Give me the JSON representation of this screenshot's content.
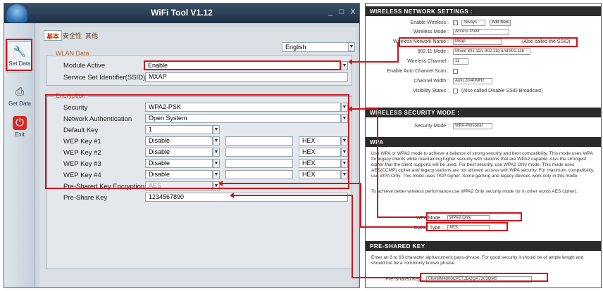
{
  "app": {
    "title": "WiFi Tool V1.12",
    "window_buttons": [
      "_",
      "□",
      "X"
    ]
  },
  "sidebar": {
    "items": [
      {
        "label": "Set Data",
        "icon": "wrench-icon"
      },
      {
        "label": "Get Data",
        "icon": "printer-icon"
      },
      {
        "label": "Exit",
        "icon": "power-icon"
      }
    ]
  },
  "tabs": [
    "基本",
    "安全性",
    "其他"
  ],
  "language": {
    "value": "English"
  },
  "wlan": {
    "title": "WLAN Data",
    "module_active_label": "Module Active",
    "module_active_value": "Enable",
    "ssid_label": "Service Set Identifier(SSID)",
    "ssid_value": "MXAP"
  },
  "encryption": {
    "title": "Encryption",
    "security_label": "Security",
    "security_value": "WPA2-PSK",
    "auth_label": "Network Authentication",
    "auth_value": "Open System",
    "default_key_label": "Default Key",
    "default_key_value": "1",
    "wep_keys": [
      {
        "label": "WEP Key #1",
        "mode": "Disable",
        "value": "",
        "format": "HEX"
      },
      {
        "label": "WEP Key #2",
        "mode": "Disable",
        "value": "",
        "format": "HEX"
      },
      {
        "label": "WEP Key #3",
        "mode": "Disable",
        "value": "",
        "format": "HEX"
      },
      {
        "label": "WEP Key #4",
        "mode": "Disable",
        "value": "",
        "format": "HEX"
      }
    ],
    "psk_enc_label": "Pre-Shared Key Encryption",
    "psk_enc_value": "AES",
    "psk_label": "Pre-Share Key",
    "psk_value": "1234567890"
  },
  "router": {
    "wireless_settings": {
      "header": "WIRELESS NETWORK SETTINGS :",
      "rows": [
        {
          "label": "Enable Wireless :",
          "value": "Always",
          "extra": "Add New"
        },
        {
          "label": "Wireless Mode :",
          "value": "Access Point"
        },
        {
          "label": "Wireless Network Name :",
          "value": "Mxap",
          "note": "(Also called the SSID)"
        },
        {
          "label": "802.11 Mode :",
          "value": "Mixed 802.11n, 802.11g and 802.11b"
        },
        {
          "label": "Wireless Channel :",
          "value": "11"
        },
        {
          "label": "Enable Auto Channel Scan :",
          "value": ""
        },
        {
          "label": "Channel Width :",
          "value": "Auto 20/40MHz"
        },
        {
          "label": "Visibility Status :",
          "value": "",
          "note": "(Also called Disable SSID Broadcast)"
        }
      ]
    },
    "security_mode": {
      "header": "WIRELESS SECURITY MODE :",
      "label": "Security Mode :",
      "value": "WPA-Personal"
    },
    "wpa": {
      "header": "WPA",
      "paragraph1": "Use WPA or WPA2 mode to achieve a balance of strong security and best compatibility. This mode uses WPA for legacy clients while maintaining higher security with stations that are WPA2 capable. Also the strongest cipher that the client supports will be used. For best security, use WPA2 Only mode. This mode uses AES(CCMP) cipher and legacy stations are not allowed access with WPA security. For maximum compatibility, use WPA Only. This mode uses TKIP cipher. Some gaming and legacy devices work only in this mode.",
      "paragraph2": "To achieve better wireless performance use WPA2 Only security mode (or in other words AES cipher).",
      "mode_label": "WPA Mode :",
      "mode_value": "WPA2 Only",
      "cipher_label": "Cipher Type :",
      "cipher_value": "AES"
    },
    "psk": {
      "header": "PRE-SHARED KEY",
      "paragraph": "Enter an 8 to 63 character alphanumeric pass-phrase. For good security it should be of ample length and should not be a commonly known phrase.",
      "label": "Pre-Shared Key :",
      "value": "0KAMM4800CPETJDQQA7203QM0"
    }
  },
  "colors": {
    "highlight": "#d0141b",
    "router_header": "#2b2b2b",
    "title_bar": "#2a3d52"
  }
}
